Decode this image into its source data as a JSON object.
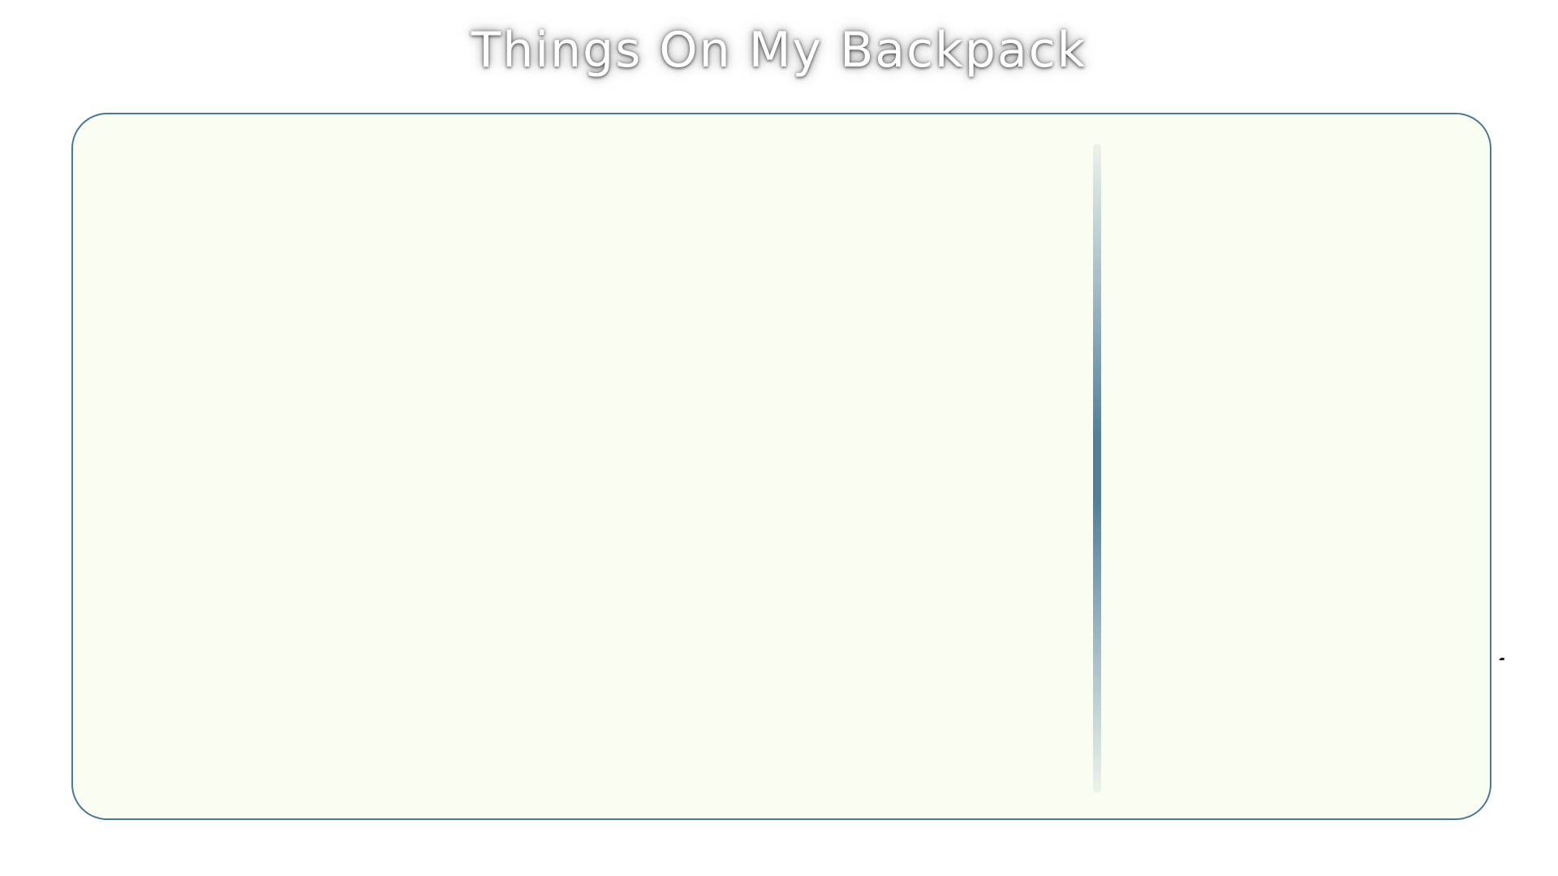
{
  "title": "Things On My Backpack",
  "colors": {
    "board_background": "#fafdf1",
    "board_border": "#4a7896",
    "divider": "#4a7896",
    "title_text": "#ffffff"
  },
  "board": {
    "items": [],
    "side_panel_items": []
  }
}
